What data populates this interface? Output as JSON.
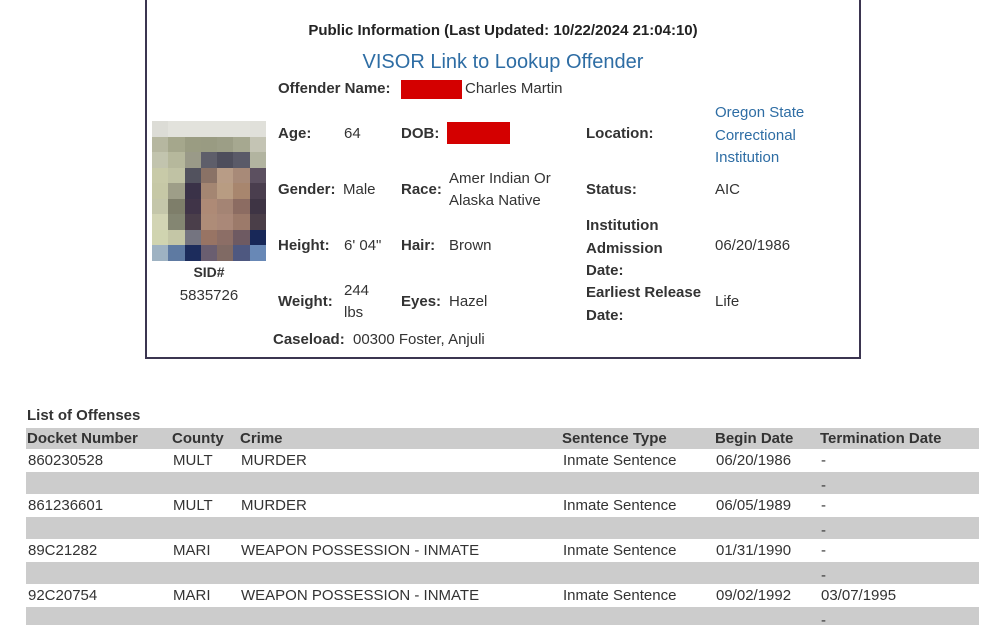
{
  "header": {
    "public_info": "Public Information (Last Updated: 10/22/2024 21:04:10)",
    "visor_link": "VISOR Link to Lookup Offender"
  },
  "offender": {
    "name_label": "Offender Name:",
    "name_value": "Charles Martin",
    "sid_label": "SID#",
    "sid_value": "5835726",
    "age_label": "Age:",
    "age_value": "64",
    "dob_label": "DOB:",
    "dob_value": "[redacted]",
    "gender_label": "Gender:",
    "gender_value": "Male",
    "race_label": "Race:",
    "race_value_line1": "Amer Indian Or",
    "race_value_line2": "Alaska Native",
    "height_label": "Height:",
    "height_value": "6' 04\"",
    "hair_label": "Hair:",
    "hair_value": "Brown",
    "weight_label": "Weight:",
    "weight_value_line1": "244",
    "weight_value_line2": "lbs",
    "eyes_label": "Eyes:",
    "eyes_value": "Hazel",
    "location_label": "Location:",
    "location_value_line1": "Oregon State",
    "location_value_line2": "Correctional",
    "location_value_line3": "Institution",
    "status_label": "Status:",
    "status_value": "AIC",
    "admission_label_line1": "Institution",
    "admission_label_line2": "Admission",
    "admission_label_line3": "Date:",
    "admission_value": "06/20/1986",
    "release_label_line1": "Earliest Release",
    "release_label_line2": "Date:",
    "release_value": "Life",
    "caseload_label": "Caseload:",
    "caseload_value": "00300 Foster, Anjuli"
  },
  "colors": {
    "link": "#2e6da4",
    "redaction": "#d40000",
    "table_header_bg": "#cccccc",
    "box_border": "#3b3550"
  },
  "offenses": {
    "title": "List of Offenses",
    "columns": [
      "Docket Number",
      "County",
      "Crime",
      "Sentence Type",
      "Begin Date",
      "Termination Date"
    ],
    "rows": [
      {
        "docket": "860230528",
        "county": "MULT",
        "crime": "MURDER",
        "sentence_type": "Inmate Sentence",
        "begin": "06/20/1986",
        "termination": "-",
        "sub_termination": "-"
      },
      {
        "docket": "861236601",
        "county": "MULT",
        "crime": "MURDER",
        "sentence_type": "Inmate Sentence",
        "begin": "06/05/1989",
        "termination": "-",
        "sub_termination": "-"
      },
      {
        "docket": "89C21282",
        "county": "MARI",
        "crime": "WEAPON POSSESSION - INMATE",
        "sentence_type": "Inmate Sentence",
        "begin": "01/31/1990",
        "termination": "-",
        "sub_termination": "-"
      },
      {
        "docket": "92C20754",
        "county": "MARI",
        "crime": "WEAPON POSSESSION - INMATE",
        "sentence_type": "Inmate Sentence",
        "begin": "09/02/1992",
        "termination": "03/07/1995",
        "sub_termination": "-"
      }
    ]
  }
}
